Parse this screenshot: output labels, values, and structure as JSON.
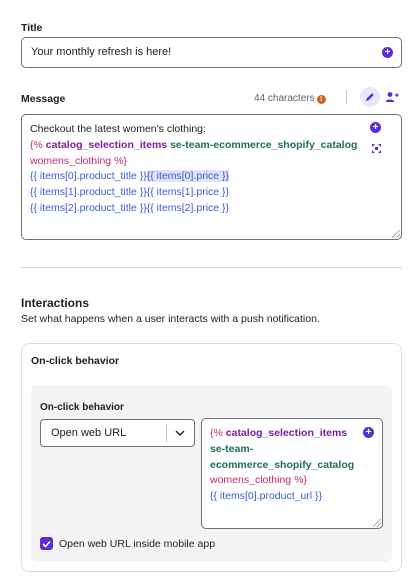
{
  "title_section": {
    "label": "Title",
    "value": "Your monthly refresh is here!",
    "add_icon": "plus-circle-icon"
  },
  "message_section": {
    "label": "Message",
    "char_count": "44 characters",
    "info_icon": "info-icon",
    "edit_icon": "pencil-icon",
    "personalize_icon": "add-user-icon",
    "expand_icon": "expand-icon",
    "lines": {
      "l1": "Checkout the latest women's clothing:",
      "l2_open": "{%",
      "l2_kw": "catalog_selection_items",
      "l2_cat": "se-team-ecommerce_shopify_catalog",
      "l3_var": "womens_clothing",
      "l3_close": "%}",
      "l4_a": "{{ items[0].product_title }}",
      "l4_b": "{{ items[0].price }}",
      "l5_a": "{{ items[1].product_title }}",
      "l5_b": "{{ items[1].price }}",
      "l6_a": "{{ items[2].product_title }}",
      "l6_b": "{{ items[2].price }}"
    }
  },
  "interactions": {
    "heading": "Interactions",
    "subtitle": "Set what happens when a user interacts with a push notification.",
    "card_title": "On-click behavior",
    "inner_label": "On-click behavior",
    "select_value": "Open web URL",
    "url_lines": {
      "l1_open": "{%",
      "l1_kw": "catalog_selection_items",
      "l2_cat": "se-team-",
      "l3_cat": "ecommerce_shopify_catalog",
      "l4_var": "womens_clothing",
      "l4_close": "%}",
      "l5": "{{ items[0].product_url }}"
    },
    "checkbox_label": "Open web URL inside mobile app",
    "checkbox_checked": true
  },
  "colors": {
    "accent": "#5b2bd8",
    "liquid_tag": "#c42a6e",
    "liquid_keyword": "#7a1fa2",
    "catalog_name": "#1e6e5f",
    "variable": "#3b5bdb",
    "info": "#d0621a"
  }
}
